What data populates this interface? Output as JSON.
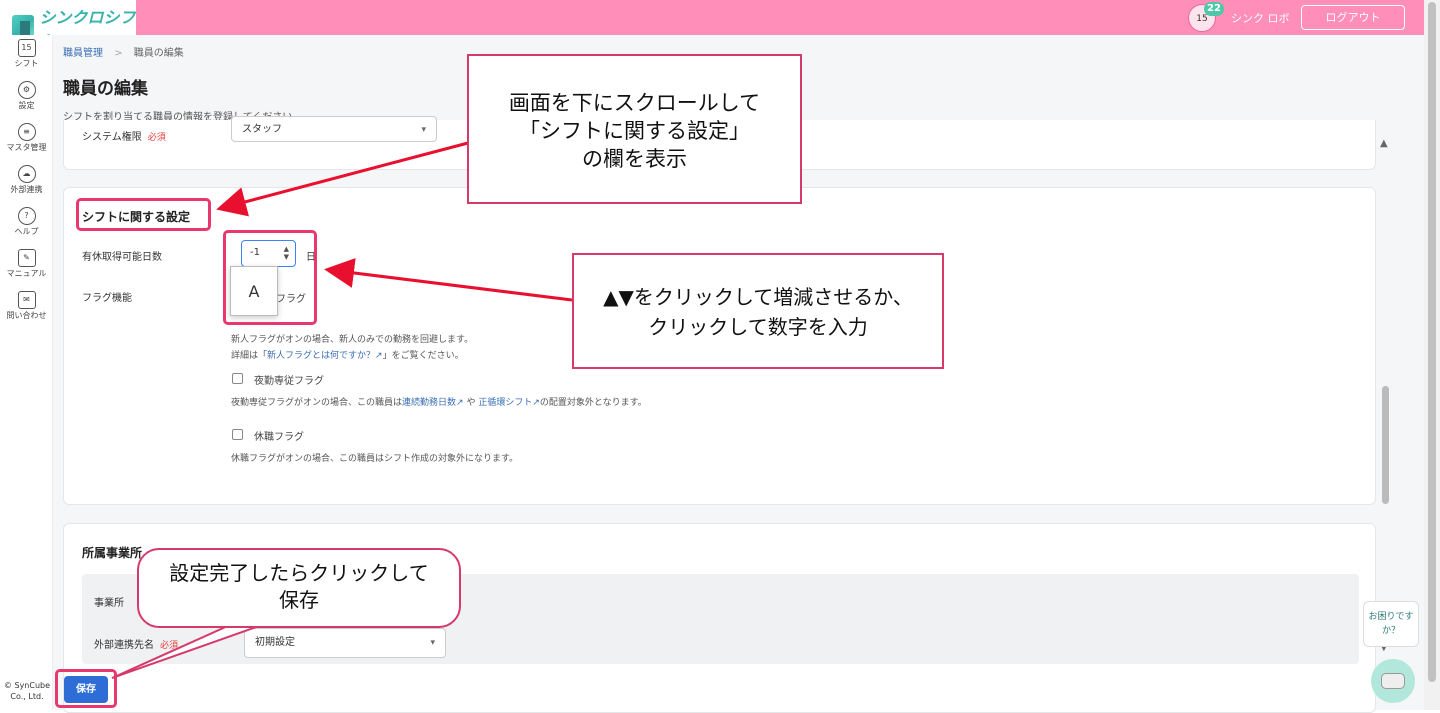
{
  "header": {
    "app_name": "シンクロシフト",
    "calendar_day": "15",
    "notification_count": "22",
    "user_name": "シンク ロボ",
    "logout_label": "ログアウト"
  },
  "sidebar": {
    "items": [
      {
        "label": "シフト",
        "icon": "calendar-icon",
        "icon_text": "15"
      },
      {
        "label": "設定",
        "icon": "gear-icon",
        "icon_text": "⚙"
      },
      {
        "label": "マスタ管理",
        "icon": "database-icon",
        "icon_text": "≡"
      },
      {
        "label": "外部連携",
        "icon": "cloud-sync-icon",
        "icon_text": "☁"
      },
      {
        "label": "ヘルプ",
        "icon": "help-icon",
        "icon_text": "?"
      },
      {
        "label": "マニュアル",
        "icon": "edit-icon",
        "icon_text": "✎"
      },
      {
        "label": "問い合わせ",
        "icon": "mail-icon",
        "icon_text": "✉"
      }
    ],
    "copyright": "© SynCube Co., Ltd."
  },
  "breadcrumb": {
    "parent": "職員管理",
    "separator": ">",
    "current": "職員の編集"
  },
  "page": {
    "title": "職員の編集",
    "description": "シフトを割り当てる職員の情報を登録してください。"
  },
  "system_section": {
    "label": "システム権限",
    "required": "必須",
    "value": "スタッフ"
  },
  "shift_section": {
    "title": "シフトに関する設定",
    "paid_leave_label": "有休取得可能日数",
    "paid_leave_value": "-1",
    "paid_leave_unit": "日",
    "ime_popup": "A",
    "flag_label": "フラグ機能",
    "new_flag_label": "フラグ",
    "new_flag_help1": "新人フラグがオンの場合、新人のみでの勤務を回避します。",
    "new_flag_help2_pre": "詳細は「",
    "new_flag_help2_link": "新人フラグとは何ですか？",
    "new_flag_help2_post": "」をご覧ください。",
    "night_flag_label": "夜勤専従フラグ",
    "night_help_pre": "夜勤専従フラグがオンの場合、この職員は",
    "night_help_link1": "連続勤務日数",
    "night_help_mid": "や",
    "night_help_link2": "正循環シフト",
    "night_help_post": "の配置対象外となります。",
    "leave_flag_label": "休職フラグ",
    "leave_help": "休職フラグがオンの場合、この職員はシフト作成の対象外になります。"
  },
  "office_section": {
    "title": "所属事業所",
    "office_label": "事業所",
    "external_label": "外部連携先名",
    "required": "必須",
    "external_value": "初期設定"
  },
  "footer": {
    "save_label": "保存"
  },
  "help_widget": {
    "text": "お困りですか？"
  },
  "annotations": {
    "note1": [
      "画面を下にスクロールして",
      "「シフトに関する設定」",
      "の欄を表示"
    ],
    "note2": [
      "▲▼をクリックして増減させるか、",
      "クリックして数字を入力"
    ],
    "note3": [
      "設定完了したらクリックして",
      "保存"
    ],
    "accent_color": "#e8386d"
  },
  "colors": {
    "header_bg": "#ff8fb8",
    "primary_button": "#2f6dd6",
    "link": "#3b6fb6"
  }
}
